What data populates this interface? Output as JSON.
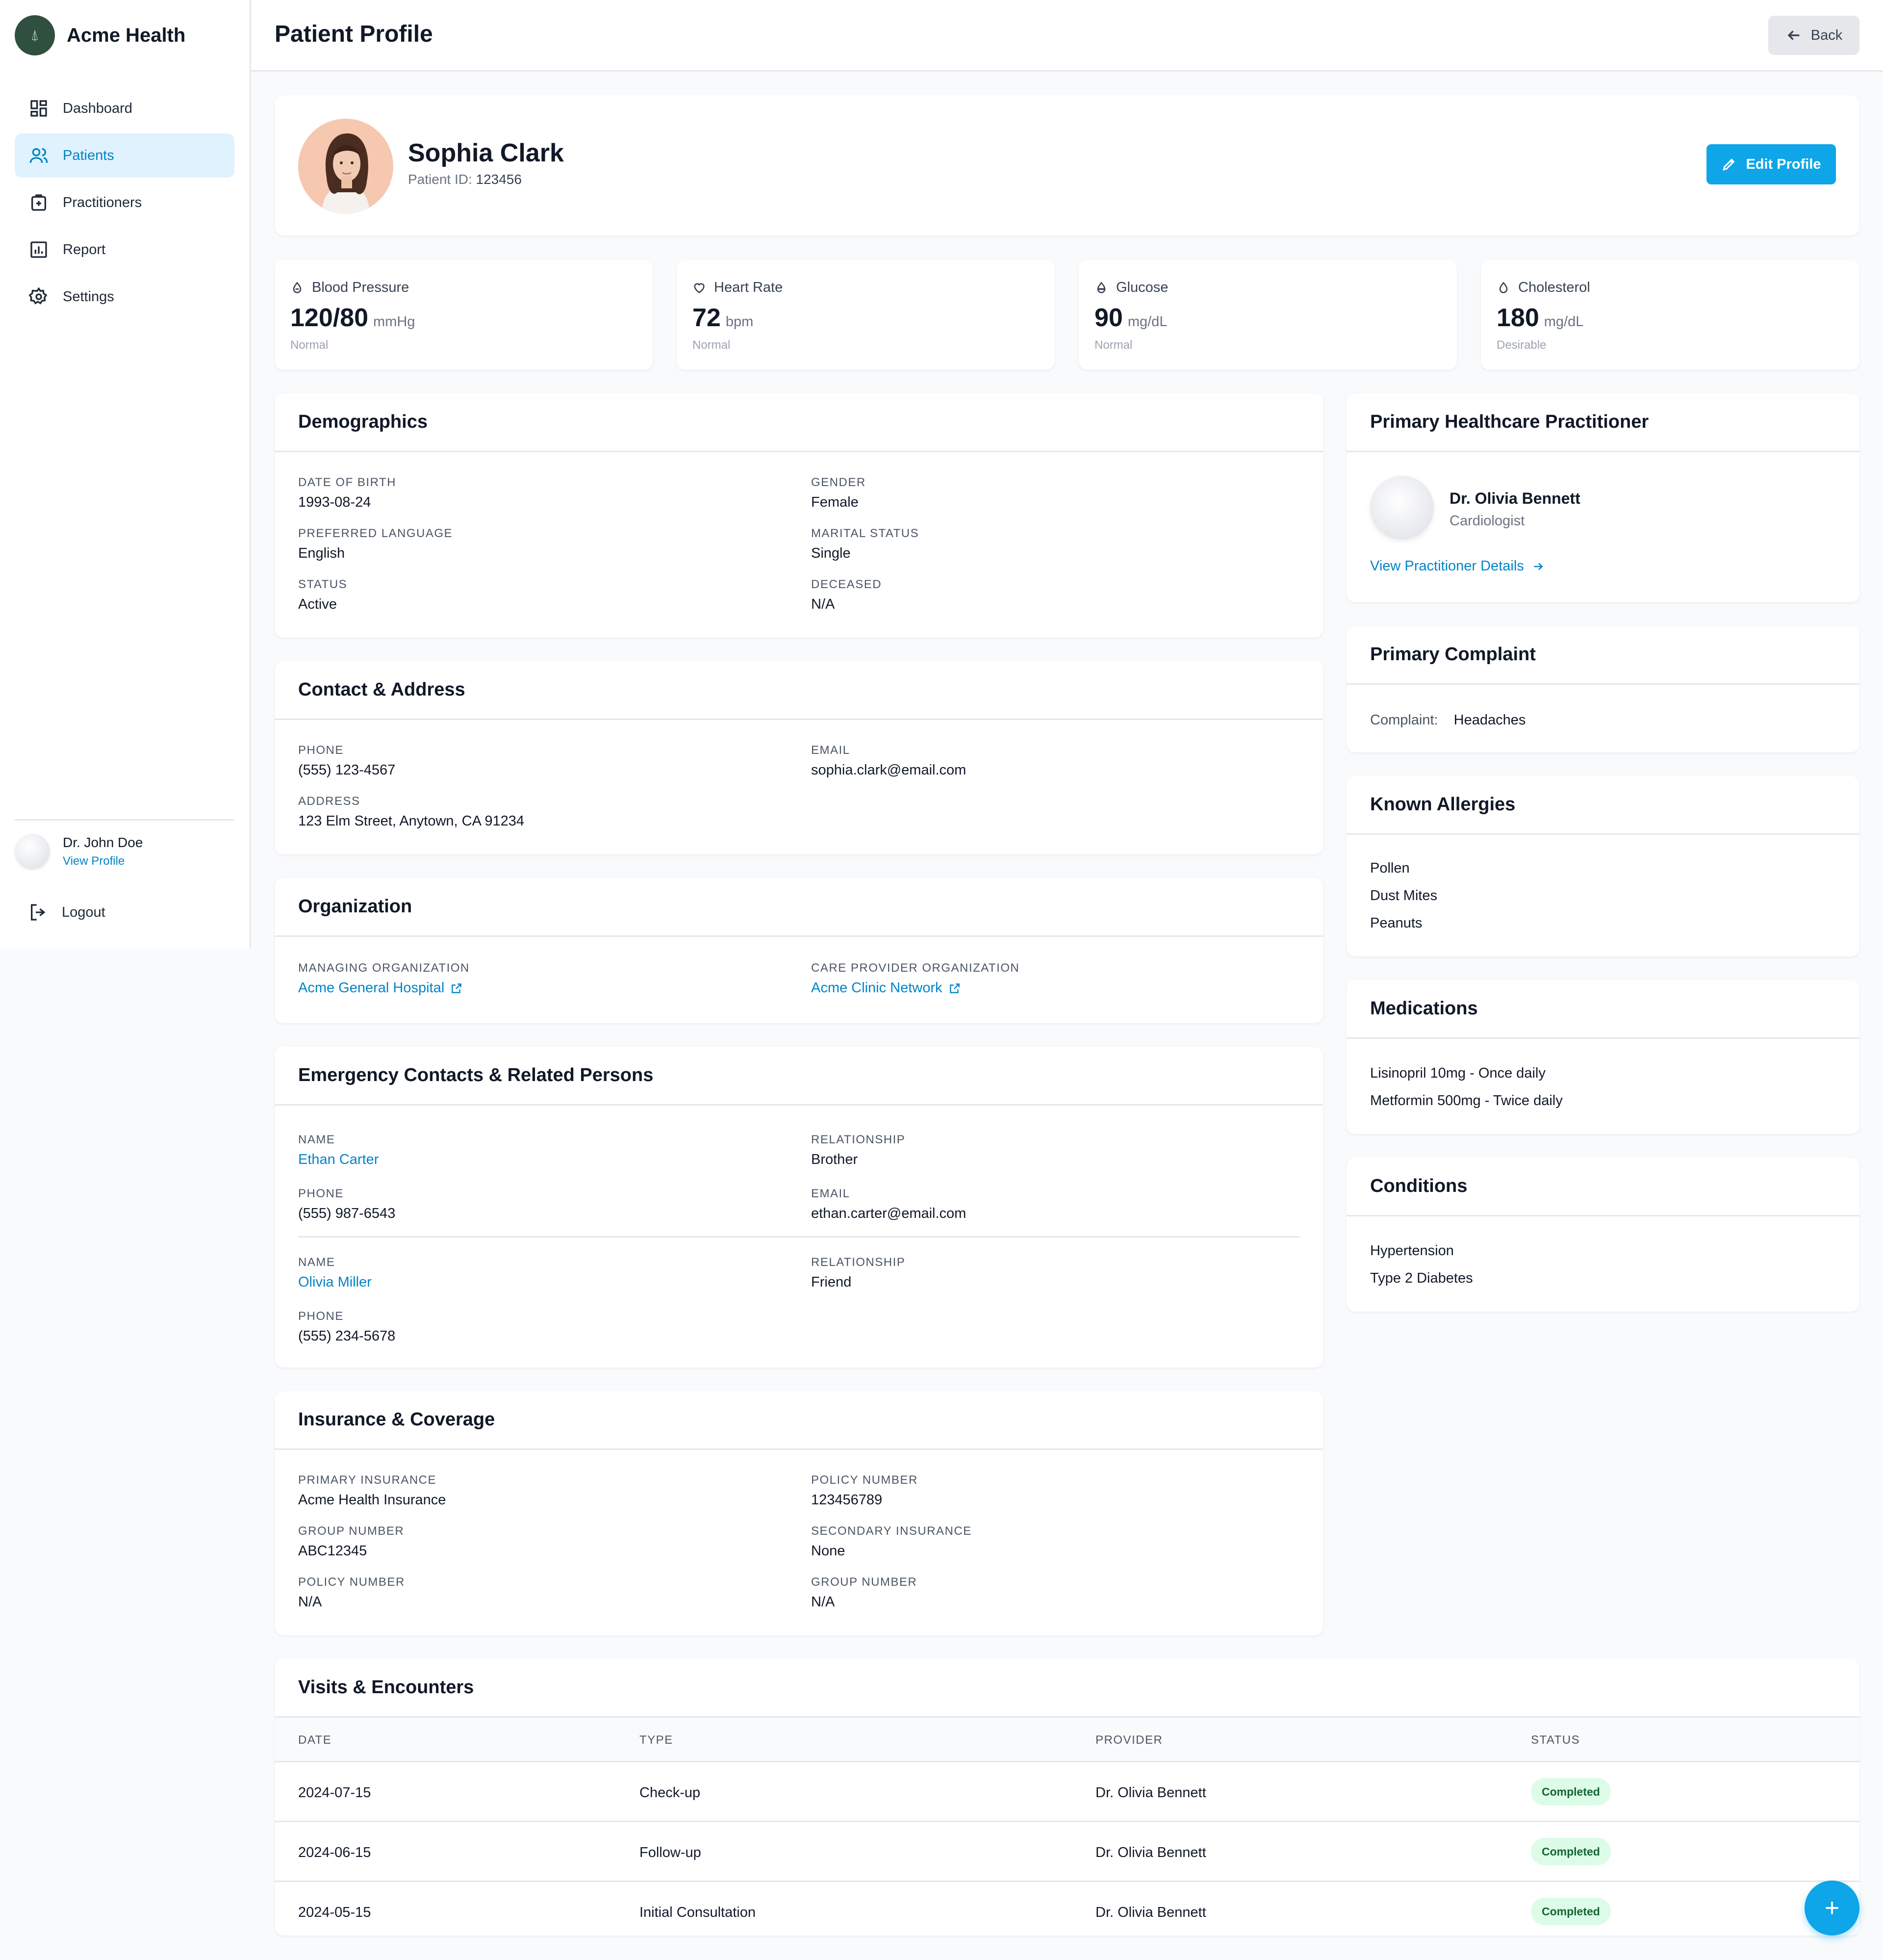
{
  "app": {
    "name": "Acme Health",
    "logo_icon": "tree-icon"
  },
  "sidebar": {
    "items": [
      {
        "label": "Dashboard",
        "icon": "dashboard-icon"
      },
      {
        "label": "Patients",
        "icon": "users-icon",
        "active": true
      },
      {
        "label": "Practitioners",
        "icon": "medical-kit-icon"
      },
      {
        "label": "Report",
        "icon": "chart-icon"
      },
      {
        "label": "Settings",
        "icon": "gear-icon"
      }
    ],
    "user": {
      "name": "Dr. John Doe",
      "link": "View Profile"
    },
    "logout": "Logout"
  },
  "header": {
    "title": "Patient Profile",
    "back": "Back"
  },
  "patient": {
    "name": "Sophia Clark",
    "id_label": "Patient ID:",
    "id": "123456",
    "edit": "Edit Profile"
  },
  "vitals": [
    {
      "label": "Blood Pressure",
      "value": "120/80",
      "unit": "mmHg",
      "note": "Normal",
      "icon": "droplet-icon"
    },
    {
      "label": "Heart Rate",
      "value": "72",
      "unit": "bpm",
      "note": "Normal",
      "icon": "heart-icon"
    },
    {
      "label": "Glucose",
      "value": "90",
      "unit": "mg/dL",
      "note": "Normal",
      "icon": "droplet-icon"
    },
    {
      "label": "Cholesterol",
      "value": "180",
      "unit": "mg/dL",
      "note": "Desirable",
      "icon": "droplet-icon"
    }
  ],
  "demographics": {
    "title": "Demographics",
    "fields": [
      {
        "label": "Date of Birth",
        "value": "1993-08-24"
      },
      {
        "label": "Gender",
        "value": "Female"
      },
      {
        "label": "Preferred Language",
        "value": "English"
      },
      {
        "label": "Marital Status",
        "value": "Single"
      },
      {
        "label": "Status",
        "value": "Active"
      },
      {
        "label": "Deceased",
        "value": "N/A"
      }
    ]
  },
  "contact": {
    "title": "Contact & Address",
    "fields": [
      {
        "label": "Phone",
        "value": "(555) 123-4567"
      },
      {
        "label": "Email",
        "value": "sophia.clark@email.com"
      },
      {
        "label": "Address",
        "value": "123 Elm Street, Anytown, CA 91234"
      }
    ]
  },
  "organization": {
    "title": "Organization",
    "fields": [
      {
        "label": "Managing Organization",
        "value": "Acme General Hospital"
      },
      {
        "label": "Care Provider Organization",
        "value": "Acme Clinic Network"
      }
    ]
  },
  "emergency": {
    "title": "Emergency Contacts & Related Persons",
    "contacts": [
      {
        "name_label": "Name",
        "name": "Ethan Carter",
        "rel_label": "Relationship",
        "rel": "Brother",
        "phone_label": "Phone",
        "phone": "(555) 987-6543",
        "email_label": "Email",
        "email": "ethan.carter@email.com"
      },
      {
        "name_label": "Name",
        "name": "Olivia Miller",
        "rel_label": "Relationship",
        "rel": "Friend",
        "phone_label": "Phone",
        "phone": "(555) 234-5678"
      }
    ]
  },
  "insurance": {
    "title": "Insurance & Coverage",
    "fields": [
      {
        "label": "Primary Insurance",
        "value": "Acme Health Insurance"
      },
      {
        "label": "Policy Number",
        "value": "123456789"
      },
      {
        "label": "Group Number",
        "value": "ABC12345"
      },
      {
        "label": "Secondary Insurance",
        "value": "None"
      },
      {
        "label": "Policy Number",
        "value": "N/A"
      },
      {
        "label": "Group Number",
        "value": "N/A"
      }
    ]
  },
  "practitioner": {
    "title": "Primary Healthcare Practitioner",
    "name": "Dr. Olivia Bennett",
    "role": "Cardiologist",
    "link": "View Practitioner Details"
  },
  "complaint": {
    "title": "Primary Complaint",
    "label": "Complaint:",
    "value": "Headaches"
  },
  "allergies": {
    "title": "Known Allergies",
    "items": [
      "Pollen",
      "Dust Mites",
      "Peanuts"
    ]
  },
  "medications": {
    "title": "Medications",
    "items": [
      "Lisinopril 10mg - Once daily",
      "Metformin 500mg - Twice daily"
    ]
  },
  "conditions": {
    "title": "Conditions",
    "items": [
      "Hypertension",
      "Type 2 Diabetes"
    ]
  },
  "visits": {
    "title": "Visits & Encounters",
    "columns": [
      "DATE",
      "TYPE",
      "PROVIDER",
      "STATUS"
    ],
    "rows": [
      {
        "date": "2024-07-15",
        "type": "Check-up",
        "provider": "Dr. Olivia Bennett",
        "status": "Completed"
      },
      {
        "date": "2024-06-15",
        "type": "Follow-up",
        "provider": "Dr. Olivia Bennett",
        "status": "Completed"
      },
      {
        "date": "2024-05-15",
        "type": "Initial Consultation",
        "provider": "Dr. Olivia Bennett",
        "status": "Completed"
      }
    ]
  },
  "fab": "+",
  "colors": {
    "accent": "#0ea5e9",
    "link": "#0284c7",
    "badge_bg": "#dcfce7",
    "badge_text": "#166534"
  }
}
